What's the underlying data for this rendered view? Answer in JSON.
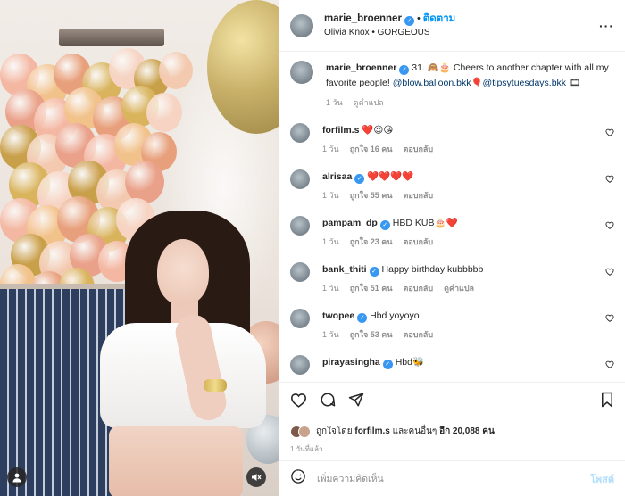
{
  "post": {
    "username": "marie_broenner",
    "follow_label": "ติดตาม",
    "audio_line": "Olivia Knox • GORGEOUS"
  },
  "caption": {
    "username": "marie_broenner",
    "text_before_links": "31. 🙈🎂 Cheers to another chapter with all my favorite people!",
    "link1": "@blow.balloon.bkk",
    "balloon_emoji": "🎈",
    "link2": "@tipsytuesdays.bkk",
    "tail_emoji": "🎞",
    "time": "1 วัน",
    "translate": "ดูคำแปล"
  },
  "comments": [
    {
      "username": "forfilm.s",
      "verified": false,
      "text": "❤️😍😘",
      "time": "1 วัน",
      "likes": "ถูกใจ 16 คน",
      "reply": "ตอบกลับ",
      "extra": ""
    },
    {
      "username": "alrisaa",
      "verified": true,
      "text": "❤️❤️❤️❤️",
      "time": "1 วัน",
      "likes": "ถูกใจ 55 คน",
      "reply": "ตอบกลับ",
      "extra": ""
    },
    {
      "username": "pampam_dp",
      "verified": true,
      "text": "HBD KUB🎂❤️",
      "time": "1 วัน",
      "likes": "ถูกใจ 23 คน",
      "reply": "ตอบกลับ",
      "extra": ""
    },
    {
      "username": "bank_thiti",
      "verified": true,
      "text": "Happy birthday kubbbbb",
      "time": "1 วัน",
      "likes": "ถูกใจ 51 คน",
      "reply": "ตอบกลับ",
      "extra": "ดูคำแปล"
    },
    {
      "username": "twopee",
      "verified": true,
      "text": "Hbd yoyoyo",
      "time": "1 วัน",
      "likes": "ถูกใจ 53 คน",
      "reply": "ตอบกลับ",
      "extra": ""
    },
    {
      "username": "pirayasingha",
      "verified": true,
      "text": "Hbd🐝",
      "time": "",
      "likes": "",
      "reply": "",
      "extra": ""
    }
  ],
  "likes": {
    "prefix": "ถูกใจโดย",
    "user": "forfilm.s",
    "middle": "และคนอื่นๆ",
    "count": "อีก 20,088 คน"
  },
  "posted_ago": "1 วันที่แล้ว",
  "add_comment": {
    "placeholder": "เพิ่มความคิดเห็น",
    "post_label": "โพสต์"
  },
  "colors": {
    "link_blue": "#0095f6",
    "verified_blue": "#3897f0",
    "meta_gray": "#8e8e8e"
  }
}
